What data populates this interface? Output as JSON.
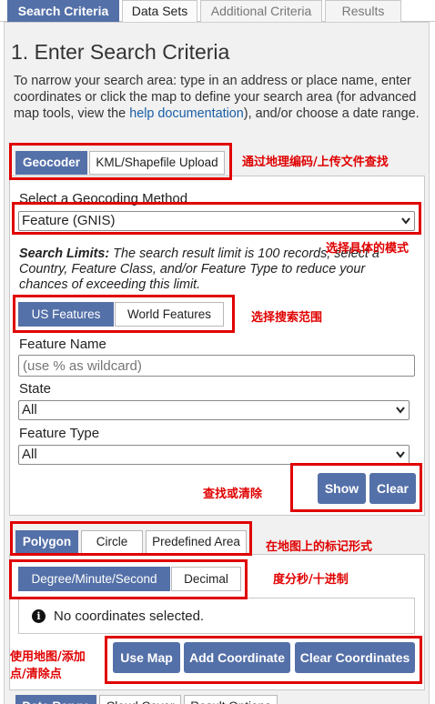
{
  "top_tabs": [
    "Search Criteria",
    "Data Sets",
    "Additional Criteria",
    "Results"
  ],
  "section_title": "1. Enter Search Criteria",
  "intro": {
    "before_link": "To narrow your search area: type in an address or place name, enter coordinates or click the map to define your search area (for advanced map tools, view the ",
    "link": "help documentation",
    "after_link": "), and/or choose a date range."
  },
  "geocoder_tabs": [
    "Geocoder",
    "KML/Shapefile Upload"
  ],
  "geocoding_method": {
    "label": "Select a Geocoding Method",
    "value": "Feature (GNIS)"
  },
  "search_limits": {
    "bold": "Search Limits:",
    "text": " The search result limit is 100 records; select a Country, Feature Class, and/or Feature Type to reduce your chances of exceeding this limit."
  },
  "feature_scope_tabs": [
    "US Features",
    "World Features"
  ],
  "feature_name": {
    "label": "Feature Name",
    "placeholder": "(use % as wildcard)"
  },
  "state": {
    "label": "State",
    "value": "All"
  },
  "feature_type": {
    "label": "Feature Type",
    "value": "All"
  },
  "show_label": "Show",
  "clear_label": "Clear",
  "shape_tabs": [
    "Polygon",
    "Circle",
    "Predefined Area"
  ],
  "coord_format_tabs": [
    "Degree/Minute/Second",
    "Decimal"
  ],
  "coords_message": "No coordinates selected.",
  "map_buttons": [
    "Use Map",
    "Add Coordinate",
    "Clear Coordinates"
  ],
  "bottom_tabs": [
    "Date Range",
    "Cloud Cover",
    "Result Options"
  ],
  "annotations": {
    "geocode_upload": "通过地理编码/上传文件查找",
    "mode_select": "选择具体的模式",
    "scope_select": "选择搜索范围",
    "find_clear": "查找或清除",
    "marker_shape": "在地图上的标记形式",
    "dms_decimal": "度分秒/十进制",
    "map_add_clear_1": "使用地图/添加",
    "map_add_clear_2": "点/清除点"
  },
  "colors": {
    "accent": "#5470a8",
    "annotation": "#e00000"
  }
}
